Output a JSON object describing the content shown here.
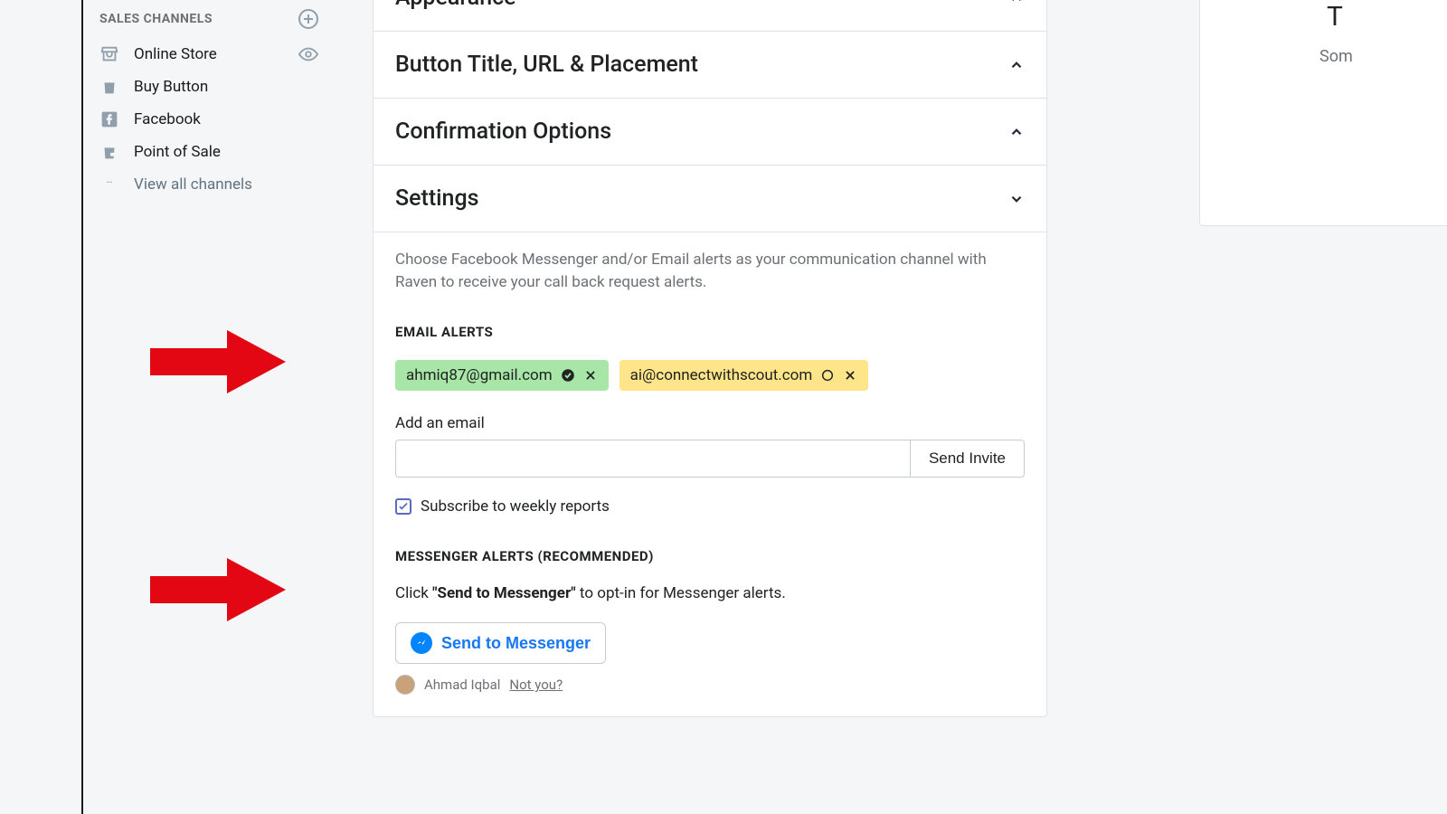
{
  "sidebar": {
    "header": "SALES CHANNELS",
    "items": [
      {
        "label": "Online Store"
      },
      {
        "label": "Buy Button"
      },
      {
        "label": "Facebook"
      },
      {
        "label": "Point of Sale"
      }
    ],
    "view_all": "View all channels"
  },
  "accordion": {
    "appearance": "Appearance",
    "button_title": "Button Title, URL & Placement",
    "confirmation": "Confirmation Options",
    "settings": {
      "title": "Settings",
      "description": "Choose Facebook Messenger and/or Email alerts as your communication channel with Raven to receive your call back request alerts.",
      "email": {
        "heading": "EMAIL ALERTS",
        "chips": [
          {
            "email": "ahmiq87@gmail.com",
            "verified": true,
            "color": "green"
          },
          {
            "email": "ai@connectwithscout.com",
            "verified": false,
            "color": "yellow"
          }
        ],
        "add_label": "Add an email",
        "send_invite": "Send Invite",
        "subscribe": "Subscribe to weekly reports"
      },
      "messenger": {
        "heading": "MESSENGER ALERTS (RECOMMENDED)",
        "line_prefix": "Click ",
        "line_bold": "\"Send to Messenger\"",
        "line_suffix": " to opt-in for Messenger alerts.",
        "button": "Send to Messenger",
        "user": "Ahmad Iqbal",
        "not_you": "Not you?"
      }
    }
  },
  "right_card": {
    "line1": "T",
    "line2": "Som"
  }
}
